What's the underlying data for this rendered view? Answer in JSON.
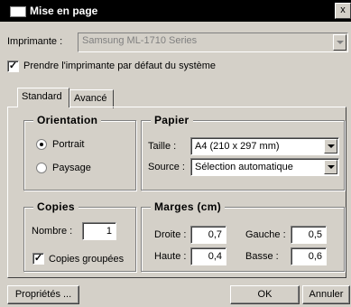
{
  "window": {
    "title": "Mise en page",
    "close": "x"
  },
  "printer": {
    "label": "Imprimante :",
    "value": "Samsung ML-1710 Series",
    "use_default_label": "Prendre l'imprimante par défaut du système",
    "use_default_checked": "✓"
  },
  "tabs": [
    {
      "label": "Standard"
    },
    {
      "label": "Avancé"
    }
  ],
  "orientation": {
    "title": "Orientation",
    "portrait": "Portrait",
    "paysage": "Paysage"
  },
  "papier": {
    "title": "Papier",
    "taille_label": "Taille :",
    "taille_value": "A4 (210 x 297 mm)",
    "source_label": "Source :",
    "source_value": "Sélection automatique"
  },
  "copies": {
    "title": "Copies",
    "nombre_label": "Nombre :",
    "nombre_value": "1",
    "groupees_label": "Copies groupées",
    "groupees_checked": "✓"
  },
  "marges": {
    "title": "Marges (cm)",
    "droite_label": "Droite :",
    "droite_value": "0,7",
    "gauche_label": "Gauche :",
    "gauche_value": "0,5",
    "haute_label": "Haute :",
    "haute_value": "0,4",
    "basse_label": "Basse :",
    "basse_value": "0,6"
  },
  "buttons": {
    "proprietes": "Propriétés ...",
    "ok": "OK",
    "annuler": "Annuler"
  }
}
